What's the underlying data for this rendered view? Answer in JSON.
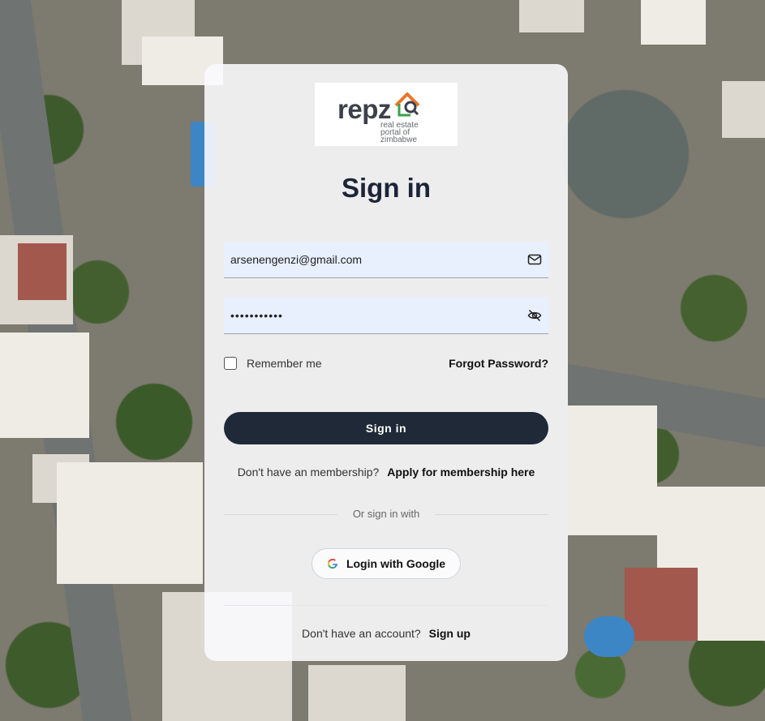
{
  "logo": {
    "word": "repz",
    "tagline": "real estate\nportal of\nzimbabwe"
  },
  "form": {
    "title": "Sign in",
    "email_value": "arsenengenzi@gmail.com",
    "password_value": "•••••••••••",
    "remember_label": "Remember me",
    "remember_checked": false,
    "forgot_label": "Forgot Password?",
    "submit_label": "Sign in"
  },
  "membership": {
    "prompt": "Don't have an membership?",
    "link": "Apply for membership here"
  },
  "alt_signin": {
    "divider_text": "Or sign in with",
    "google_label": "Login with Google"
  },
  "signup": {
    "prompt": "Don't have an account?",
    "link": "Sign up"
  },
  "icons": {
    "email": "mail-icon",
    "password_toggle": "eye-off-icon",
    "google": "google-icon"
  },
  "colors": {
    "primary_button": "#1f2937",
    "input_fill": "#e8f0fd",
    "logo_accent_orange": "#e9772b",
    "logo_accent_green": "#3aa24a"
  }
}
